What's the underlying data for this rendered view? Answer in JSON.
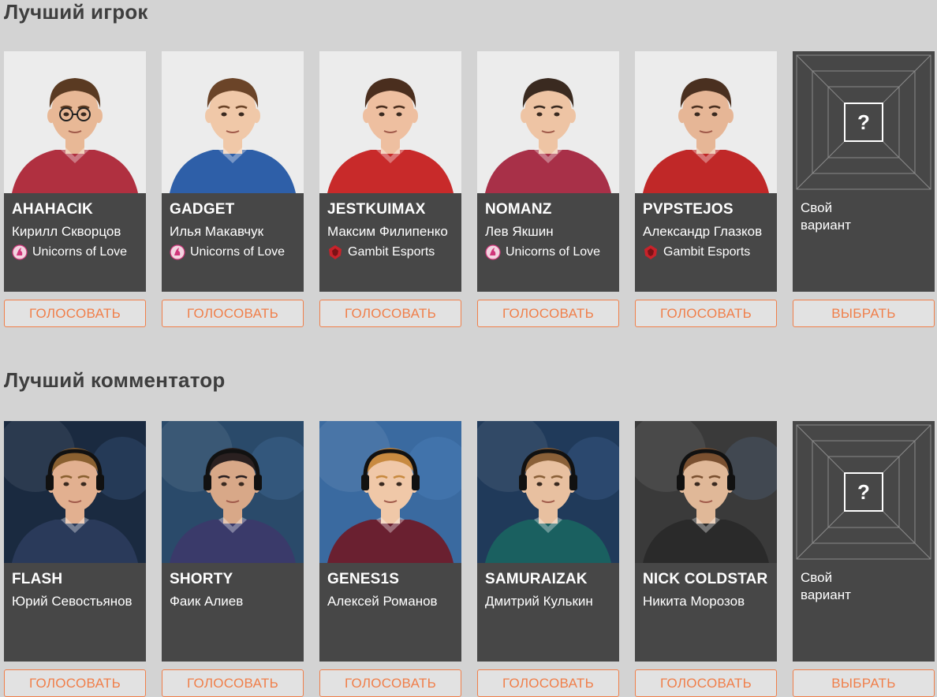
{
  "sections": [
    {
      "title": "Лучший игрок",
      "cards": [
        {
          "nick": "AHAHACIK",
          "name": "Кирилл Скворцов",
          "team": "Unicorns of Love",
          "team_logo": "unicorns-of-love-logo",
          "skin": "#e8b896",
          "hair": "#5a3a22",
          "shirt": "#b03040",
          "bg": "#ececec",
          "glasses": true
        },
        {
          "nick": "GADGET",
          "name": "Илья Макавчук",
          "team": "Unicorns of Love",
          "team_logo": "unicorns-of-love-logo",
          "skin": "#f0c8a8",
          "hair": "#6b4428",
          "shirt": "#2e5fa8",
          "bg": "#ececec",
          "glasses": false
        },
        {
          "nick": "JESTKUIMAX",
          "name": "Максим Филипенко",
          "team": "Gambit Esports",
          "team_logo": "gambit-esports-logo",
          "skin": "#eebfa0",
          "hair": "#4a2e1e",
          "shirt": "#c82a2a",
          "bg": "#ececec",
          "glasses": false
        },
        {
          "nick": "NOMANZ",
          "name": "Лев Якшин",
          "team": "Unicorns of Love",
          "team_logo": "unicorns-of-love-logo",
          "skin": "#eec4a4",
          "hair": "#3a2a20",
          "shirt": "#a83048",
          "bg": "#ececec",
          "glasses": false
        },
        {
          "nick": "PVPSTEJOS",
          "name": "Александр Глазков",
          "team": "Gambit Esports",
          "team_logo": "gambit-esports-logo",
          "skin": "#e6b696",
          "hair": "#4a3020",
          "shirt": "#c02828",
          "bg": "#ececec",
          "glasses": false
        }
      ],
      "custom": {
        "label": "Свой вариант",
        "button": "ВЫБРАТЬ",
        "question": "?"
      },
      "vote_label": "ГОЛОСОВАТЬ"
    },
    {
      "title": "Лучший комментатор",
      "cards": [
        {
          "nick": "FLASH",
          "name": "Юрий Севостьянов",
          "skin": "#e2b090",
          "hair": "#8a6030",
          "shirt": "#2a3a5a",
          "bg": "#1a2a40"
        },
        {
          "nick": "SHORTY",
          "name": "Фаик Алиев",
          "skin": "#d8a888",
          "hair": "#2a2020",
          "shirt": "#3a3a6a",
          "bg": "#2a4a6a"
        },
        {
          "nick": "GENES1S",
          "name": "Алексей Романов",
          "skin": "#f0c8a8",
          "hair": "#c88a40",
          "shirt": "#6a2030",
          "bg": "#3a6aa0"
        },
        {
          "nick": "SAMURAIZAK",
          "name": "Дмитрий Кулькин",
          "skin": "#e8c0a0",
          "hair": "#8a6038",
          "shirt": "#1a6060",
          "bg": "#203a5a"
        },
        {
          "nick": "NICK COLDSTAR",
          "name": "Никита Морозов",
          "skin": "#e0b898",
          "hair": "#7a5030",
          "shirt": "#2a2a2a",
          "bg": "#3a3a3a"
        }
      ],
      "custom": {
        "label": "Свой вариант",
        "button": "ВЫБРАТЬ",
        "question": "?"
      },
      "vote_label": "ГОЛОСОВАТЬ"
    }
  ],
  "colors": {
    "accent": "#f07f4a",
    "card_bg": "#474747",
    "page_bg": "#d3d3d3"
  }
}
